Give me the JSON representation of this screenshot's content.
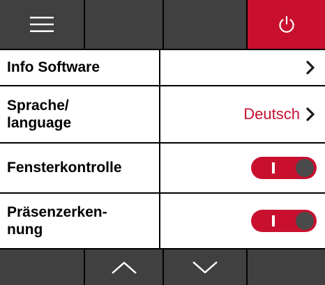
{
  "header": {
    "menu_icon": "hamburger-icon",
    "power_icon": "power-icon",
    "power_color": "#c8102e"
  },
  "settings": {
    "info_software": {
      "label": "Info Software",
      "icon": "chevron-right-icon"
    },
    "language": {
      "label_line1": "Sprache/",
      "label_line2": "language",
      "value": "Deutsch",
      "icon": "chevron-right-icon"
    },
    "window_control": {
      "label": "Fensterkontrolle",
      "state": "on"
    },
    "presence_detection": {
      "label_line1": "Präsenzerken-",
      "label_line2": "nung",
      "state": "on"
    }
  },
  "footer": {
    "up_icon": "chevron-up-icon",
    "down_icon": "chevron-down-icon"
  },
  "colors": {
    "accent": "#c8102e",
    "bar": "#404040",
    "knob": "#4a4a4a"
  }
}
